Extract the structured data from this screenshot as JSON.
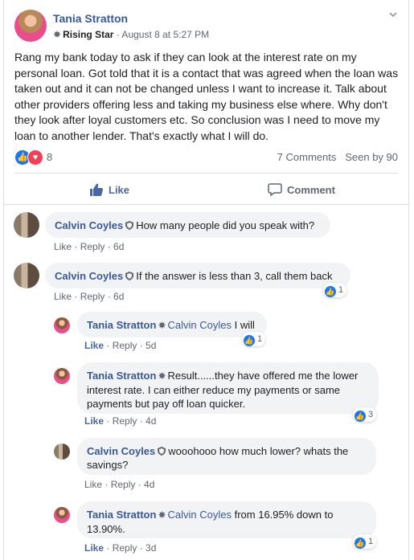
{
  "post": {
    "author": "Tania Stratton",
    "badge": "Rising Star",
    "timestamp": "· August 8 at 5:27 PM",
    "text": "Rang my bank today to ask if they can look at the interest rate on my personal loan. Got told that it is a contact that was agreed when the loan was taken out and it can not be changed unless I want to increase it. Talk about other providers offering less and taking my business else where. Why don't they look after loyal customers etc. So conclusion was I need to move my loan to another lender. That's exactly what I will do.",
    "reaction_count": "8",
    "comments_count": "7 Comments",
    "seen_by": "Seen by 90"
  },
  "actions": {
    "like": "Like",
    "comment": "Comment"
  },
  "comments": [
    {
      "author": "Calvin Coyles",
      "text": "How many people did you speak with?",
      "like": "Like",
      "reply": "Reply",
      "age": "6d",
      "reactions": ""
    },
    {
      "author": "Calvin Coyles",
      "text": "If the answer is less than 3, call them back",
      "like": "Like",
      "reply": "Reply",
      "age": "6d",
      "reactions": "1"
    }
  ],
  "replies": [
    {
      "author": "Tania Stratton",
      "mention": "Calvin Coyles",
      "text": " I will",
      "like": "Like",
      "reply": "Reply",
      "age": "5d",
      "reactions": "1"
    },
    {
      "author": "Tania Stratton",
      "mention": "",
      "text": "Result......they have offered me the lower interest rate. I can either reduce my payments or same payments but pay off loan quicker.",
      "like": "Like",
      "reply": "Reply",
      "age": "4d",
      "reactions": "3"
    },
    {
      "author": "Calvin Coyles",
      "mention": "",
      "text": "wooohooo how much lower? whats the savings?",
      "like": "Like",
      "reply": "Reply",
      "age": "4d",
      "reactions": ""
    },
    {
      "author": "Tania Stratton",
      "mention": "Calvin Coyles",
      "text": " from 16.95% down to 13.90%.",
      "like": "Like",
      "reply": "Reply",
      "age": "3d",
      "reactions": "1"
    }
  ],
  "colors": {
    "link": "#385898",
    "like_blue": "#1877f2",
    "love_red": "#f33e58",
    "bubble": "#f2f3f5"
  },
  "icons": [
    "star-icon",
    "chevron-down-icon",
    "like-reaction-icon",
    "love-reaction-icon",
    "thumbs-up-icon",
    "comment-icon",
    "shield-icon"
  ]
}
